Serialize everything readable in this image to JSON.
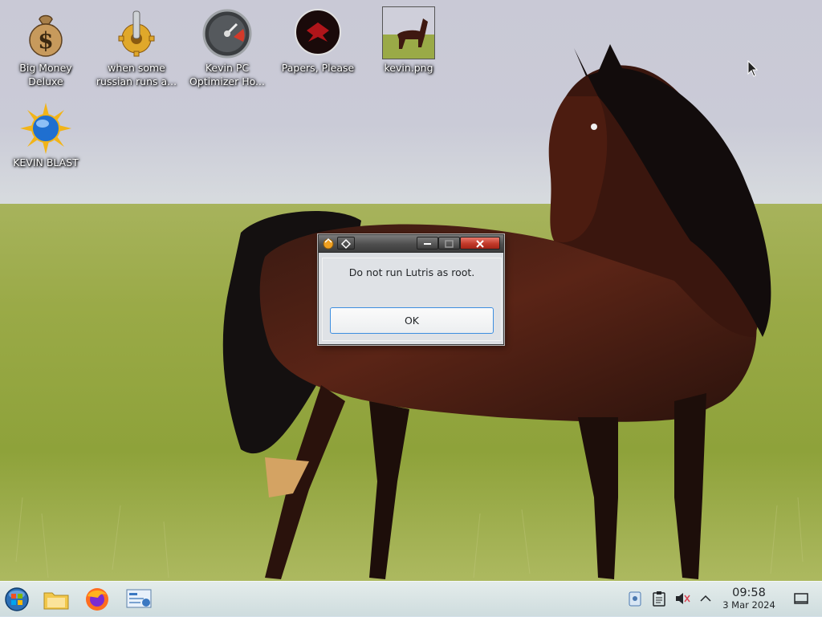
{
  "desktop": {
    "icons": [
      {
        "label": "Big Money Deluxe",
        "icon": "money-bag-icon"
      },
      {
        "label": "when some russian runs a...",
        "icon": "gear-lever-icon"
      },
      {
        "label": "Kevin PC Optimizer Ho...",
        "icon": "speedometer-icon"
      },
      {
        "label": "Papers, Please",
        "icon": "papers-please-emblem-icon"
      },
      {
        "label": "kevin.png",
        "icon": "horse-image-thumbnail"
      },
      {
        "label": "KEVIN BLAST",
        "icon": "sun-globe-icon"
      }
    ],
    "icon_labels": {
      "big_money_1": "Big Money",
      "big_money_2": "Deluxe",
      "russian_1": "when some",
      "russian_2": "russian runs a...",
      "kevin_pc_1": "Kevin PC",
      "kevin_pc_2": "Optimizer Ho...",
      "papers": "Papers, Please",
      "kevin_png": "kevin.png",
      "kevin_blast": "KEVIN BLAST"
    }
  },
  "dialog": {
    "message": "Do not run Lutris as root.",
    "ok_label": "OK",
    "titlebar_buttons": [
      "app-icon",
      "pin-icon",
      "minimize-icon",
      "maximize-icon",
      "close-icon"
    ]
  },
  "taskbar": {
    "launchers": [
      "start-menu-orb-icon",
      "file-manager-icon",
      "firefox-icon",
      "system-settings-icon"
    ],
    "tray": [
      "notifications-icon",
      "clipboard-icon",
      "volume-muted-icon",
      "tray-expand-chevron-icon"
    ],
    "time": "09:58",
    "date": "3 Mar 2024",
    "show_desktop": "show-desktop-icon"
  },
  "colors": {
    "accent": "#3d8ee0",
    "close_button": "#c23a2a",
    "titlebar": "#4e4e4e",
    "dialog_bg": "#dcdfe3"
  }
}
